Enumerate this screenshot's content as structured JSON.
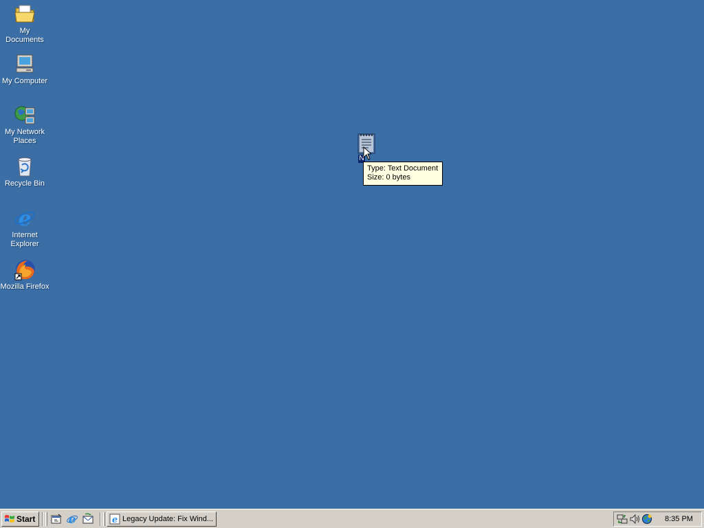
{
  "desktop": {
    "icons": [
      {
        "label": "My Documents",
        "icon": "my-documents-icon"
      },
      {
        "label": "My Computer",
        "icon": "my-computer-icon"
      },
      {
        "label": "My Network Places",
        "icon": "network-places-icon"
      },
      {
        "label": "Recycle Bin",
        "icon": "recycle-bin-icon"
      },
      {
        "label": "Internet Explorer",
        "icon": "internet-explorer-icon"
      },
      {
        "label": "Mozilla Firefox",
        "icon": "firefox-icon"
      }
    ],
    "text_file": {
      "label": "N",
      "icon": "text-document-icon"
    },
    "tooltip": {
      "type_line": "Type: Text Document",
      "size_line": "Size: 0 bytes"
    }
  },
  "taskbar": {
    "start_label": "Start",
    "quick_launch": [
      "show-desktop-icon",
      "ie-quick-launch-icon",
      "outlook-express-icon"
    ],
    "tasks": [
      {
        "label": "Legacy Update: Fix Wind...",
        "icon": "internet-explorer-icon"
      }
    ],
    "tray": {
      "icons": [
        "network-icon",
        "volume-icon",
        "globe-icon"
      ],
      "clock": "8:35 PM"
    }
  },
  "colors": {
    "desktop_bg": "#3a6ea5",
    "taskbar_bg": "#d4d0c8",
    "tooltip_bg": "#ffffe1"
  }
}
